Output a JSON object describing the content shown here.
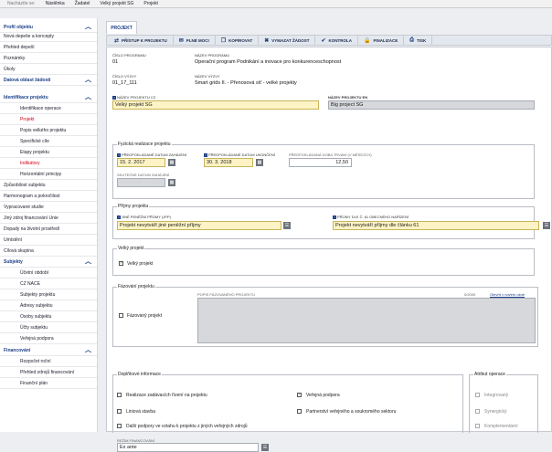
{
  "breadcrumb": {
    "label": "Nacházíte se:",
    "items": [
      "Nástěnka",
      "Žadatel",
      "Velký projekt SG",
      "Projekt"
    ]
  },
  "sidebar": {
    "items": [
      {
        "label": "Profil objektu",
        "kind": "sec",
        "chevron": "︿"
      },
      {
        "label": "Nová depeše a koncepty",
        "kind": "item"
      },
      {
        "label": "Přehled depeší",
        "kind": "item"
      },
      {
        "label": "Poznámky",
        "kind": "item"
      },
      {
        "label": "Úkoly",
        "kind": "item"
      },
      {
        "label": "Datová oblast žádosti",
        "kind": "sec",
        "chevron": "︿"
      },
      {
        "label": "Identifikace projektu",
        "kind": "sec2",
        "chevron": "︿"
      },
      {
        "label": "Identifikace operace",
        "kind": "sub"
      },
      {
        "label": "Projekt",
        "kind": "sub-act"
      },
      {
        "label": "Popis velkého projektu",
        "kind": "sub"
      },
      {
        "label": "Specifické cíle",
        "kind": "sub"
      },
      {
        "label": "Etapy projektu",
        "kind": "sub"
      },
      {
        "label": "Indikátory",
        "kind": "sub-act"
      },
      {
        "label": "Horizontální principy",
        "kind": "sub"
      },
      {
        "label": "Způsobilost subjektu",
        "kind": "item"
      },
      {
        "label": "Harmonogram a pokročilost",
        "kind": "item"
      },
      {
        "label": "Vypracované studie",
        "kind": "item"
      },
      {
        "label": "Jiný zdroj financování Unie",
        "kind": "item"
      },
      {
        "label": "Dopady na životní prostředí",
        "kind": "item"
      },
      {
        "label": "Umístění",
        "kind": "item"
      },
      {
        "label": "Cílová skupina",
        "kind": "item"
      },
      {
        "label": "Subjekty",
        "kind": "sec2",
        "chevron": "︿"
      },
      {
        "label": "Účetní období",
        "kind": "sub"
      },
      {
        "label": "CZ NACE",
        "kind": "sub"
      },
      {
        "label": "Subjekty projektu",
        "kind": "sub"
      },
      {
        "label": "Adresy subjektu",
        "kind": "sub"
      },
      {
        "label": "Osoby subjektu",
        "kind": "sub"
      },
      {
        "label": "Účty subjektu",
        "kind": "sub"
      },
      {
        "label": "Veřejná podpora",
        "kind": "sub"
      },
      {
        "label": "Financování",
        "kind": "sec2",
        "chevron": "︿"
      },
      {
        "label": "Rozpočet roční",
        "kind": "sub"
      },
      {
        "label": "Přehled zdrojů financování",
        "kind": "sub"
      },
      {
        "label": "Finanční plán",
        "kind": "sub"
      }
    ]
  },
  "tab": {
    "label": "PROJEKT"
  },
  "toolbar": {
    "buttons": [
      {
        "label": "PŘÍSTUP K PROJEKTU",
        "icon": "⇄"
      },
      {
        "label": "PLNÉ MOCI",
        "icon": "✉"
      },
      {
        "label": "KOPÍROVAT",
        "icon": "❐"
      },
      {
        "label": "VYMAZAT ŽÁDOST",
        "icon": "✖"
      },
      {
        "label": "KONTROLA",
        "icon": "✔"
      },
      {
        "label": "FINALIZACE",
        "icon": "🔒"
      },
      {
        "label": "TISK",
        "icon": "⎙"
      }
    ]
  },
  "form": {
    "cislo_programu_label": "ČÍSLO PROGRAMU",
    "cislo_programu": "01",
    "nazev_programu_label": "NÁZEV PROGRAMU",
    "nazev_programu": "Operační program Podnikání a inovace pro konkurenceschopnost",
    "cislo_vyzvy_label": "ČÍSLO VÝZVY",
    "cislo_vyzvy": "01_17_111",
    "nazev_vyzvy_label": "NÁZEV VÝZVY",
    "nazev_vyzvy": "Smart grids II. - Přenosová síť - velké projekty",
    "nazev_cz_label": "NÁZEV PROJEKTU CZ",
    "nazev_cz": "Velký projekt SG",
    "nazev_en_label": "NÁZEV PROJEKTU EN",
    "nazev_en": "Big project SG"
  },
  "realizace": {
    "title": "Fyzická realizace projektu",
    "start_label": "PŘEDPOKLÁDANÉ DATUM ZAHÁJENÍ",
    "start": "15. 2. 2017",
    "end_label": "PŘEDPOKLÁDANÉ DATUM UKONČENÍ",
    "end": "30. 3. 2018",
    "dur_label": "PŘEDPOKLÁDANÁ DOBA TRVÁNÍ (V MĚSÍCÍCH)",
    "dur": "12,50",
    "real_start_label": "SKUTEČNÉ DATUM ZAHÁJENÍ"
  },
  "prijmy": {
    "title": "Příjmy projektu",
    "jine_label": "JINÉ PENĚŽNÍ PŘÍJMY (JPP)",
    "jine": "Projekt nevytváří jiné peněžní příjmy",
    "cl61_label": "PŘÍJMY DLE Č. 61 OBECNÉHO NAŘÍZENÍ",
    "cl61": "Projekt nevytváří příjmy dle článku 61"
  },
  "velky": {
    "title": "Velký projekt",
    "cb_label": "Velký projekt"
  },
  "fazovani": {
    "title": "Fázování projektu",
    "cb_label": "Fázovaný projekt",
    "popis_label": "POPIS FÁZOVANÉHO PROJEKTU",
    "counter": "0/2000",
    "link": "Otevřít v novém okně"
  },
  "doplnkove": {
    "title": "Doplňkové informace",
    "c1": "Realizace zadávacích řízení na projektu",
    "c2": "Veřejná podpora",
    "c3": "Liniová stavba",
    "c4": "Partnerství veřejného a soukromého sektoru",
    "c5": "Další podpory ve vztahu k projektu z jiných veřejných zdrojů",
    "rezim_label": "REŽIM FINANCOVÁNÍ",
    "rezim": "Ex ante"
  },
  "atribut": {
    "title": "Atribut operace",
    "c1": "Integrovaný",
    "c2": "Synergický",
    "c3": "Komplementární"
  }
}
